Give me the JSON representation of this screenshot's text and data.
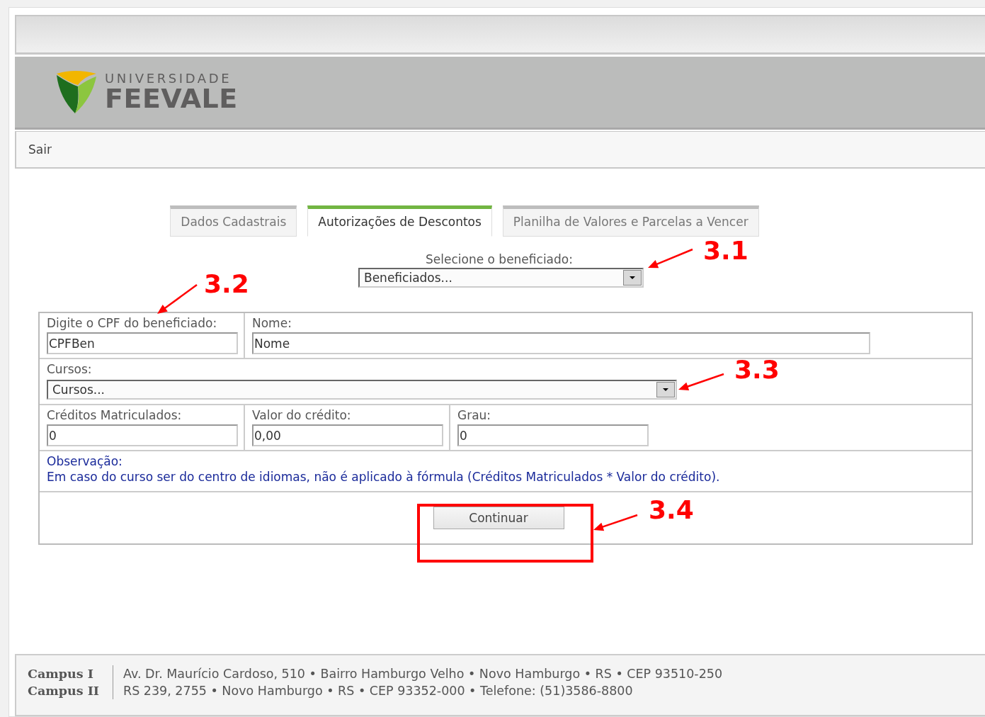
{
  "header": {
    "logo_top": "UNIVERSIDADE",
    "logo_name": "FEEVALE"
  },
  "nav": {
    "link": "Sair"
  },
  "tabs": [
    {
      "label": "Dados Cadastrais",
      "selected": false
    },
    {
      "label": "Autorizações de Descontos",
      "selected": true
    },
    {
      "label": "Planilha de Valores e Parcelas a Vencer",
      "selected": false
    }
  ],
  "beneficiary": {
    "label": "Selecione o beneficiado:",
    "value": "Beneficiados..."
  },
  "form": {
    "cpf": {
      "label": "Digite o CPF do beneficiado:",
      "value": "CPFBen"
    },
    "name": {
      "label": "Nome:",
      "value": "Nome"
    },
    "courses": {
      "label": "Cursos:",
      "value": "Cursos..."
    },
    "credits": {
      "label": "Créditos Matriculados:",
      "value": "0"
    },
    "credit_value": {
      "label": "Valor do crédito:",
      "value": "0,00"
    },
    "grade": {
      "label": "Grau:",
      "value": "0"
    },
    "note_title": "Observação:",
    "note": "Em caso do curso ser do centro de idiomas, não é aplicado à fórmula (Créditos Matriculados * Valor do crédito).",
    "button": "Continuar"
  },
  "annotations": [
    {
      "label": "3.1"
    },
    {
      "label": "3.2"
    },
    {
      "label": "3.3"
    },
    {
      "label": "3.4"
    }
  ],
  "footer": [
    {
      "campus": "Campus I",
      "address": "Av. Dr. Maurício Cardoso, 510 • Bairro Hamburgo Velho • Novo Hamburgo • RS • CEP 93510-250"
    },
    {
      "campus": "Campus II",
      "address": "RS 239, 2755 • Novo Hamburgo • RS • CEP 93352-000 • Telefone: (51)3586-8800"
    }
  ]
}
